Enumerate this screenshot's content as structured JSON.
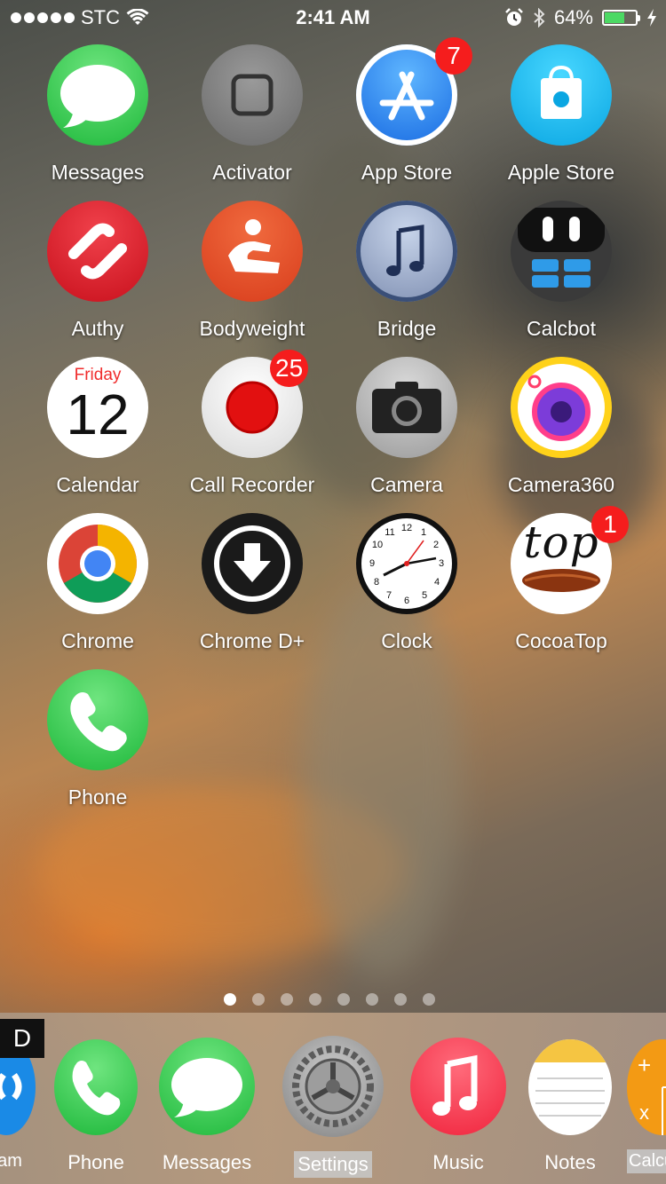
{
  "status_bar": {
    "carrier": "STC",
    "time": "2:41 AM",
    "battery_percent": "64%",
    "battery_level": 0.64
  },
  "apps": [
    {
      "label": "Messages",
      "icon": "messages-icon"
    },
    {
      "label": "Activator",
      "icon": "activator-icon"
    },
    {
      "label": "App Store",
      "icon": "app-store-icon",
      "badge": "7"
    },
    {
      "label": "Apple Store",
      "icon": "apple-store-icon"
    },
    {
      "label": "Authy",
      "icon": "authy-icon"
    },
    {
      "label": "Bodyweight",
      "icon": "bodyweight-icon"
    },
    {
      "label": "Bridge",
      "icon": "bridge-icon"
    },
    {
      "label": "Calcbot",
      "icon": "calcbot-icon"
    },
    {
      "label": "Calendar",
      "icon": "calendar-icon",
      "weekday": "Friday",
      "day": "12"
    },
    {
      "label": "Call Recorder",
      "icon": "call-recorder-icon",
      "badge": "25"
    },
    {
      "label": "Camera",
      "icon": "camera-icon"
    },
    {
      "label": "Camera360",
      "icon": "camera360-icon"
    },
    {
      "label": "Chrome",
      "icon": "chrome-icon"
    },
    {
      "label": "Chrome D+",
      "icon": "chrome-download-icon"
    },
    {
      "label": "Clock",
      "icon": "clock-icon"
    },
    {
      "label": "CocoaTop",
      "icon": "cocoatop-icon",
      "badge": "1",
      "logo_text": "top"
    },
    {
      "label": "Phone",
      "icon": "phone-icon"
    }
  ],
  "page_indicator": {
    "pages": 8,
    "current": 1
  },
  "dock": {
    "badge_letter": "D",
    "items": [
      {
        "label": "azam",
        "icon": "shazam-icon"
      },
      {
        "label": "Phone",
        "icon": "phone-icon"
      },
      {
        "label": "Messages",
        "icon": "messages-icon"
      },
      {
        "label": "Settings",
        "icon": "settings-icon",
        "selected": true
      },
      {
        "label": "Music",
        "icon": "music-icon"
      },
      {
        "label": "Notes",
        "icon": "notes-icon"
      },
      {
        "label": "Calcu",
        "icon": "calculator-icon"
      }
    ]
  },
  "colors": {
    "badge": "#f51d1d",
    "messages": "#3fd15a",
    "app_store": "#1c7ff0",
    "authy": "#e3202c",
    "bodyweight": "#e64a26"
  }
}
